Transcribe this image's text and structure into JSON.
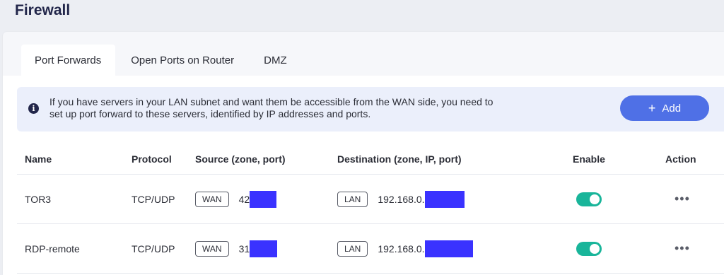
{
  "page": {
    "title": "Firewall"
  },
  "tabs": [
    {
      "label": "Port Forwards",
      "active": true
    },
    {
      "label": "Open Ports on Router",
      "active": false
    },
    {
      "label": "DMZ",
      "active": false
    }
  ],
  "info": {
    "text": "If you have servers in your LAN subnet and want them be accessible from the WAN side, you need to set up port forward to these servers, identified by IP addresses and ports.",
    "add_label": "Add",
    "add_icon": "plus-icon"
  },
  "table": {
    "headers": {
      "name": "Name",
      "protocol": "Protocol",
      "source": "Source (zone, port)",
      "destination": "Destination (zone, IP, port)",
      "enable": "Enable",
      "action": "Action"
    },
    "rows": [
      {
        "name": "TOR3",
        "protocol": "TCP/UDP",
        "source_zone": "WAN",
        "source_port": "42",
        "dest_zone": "LAN",
        "dest_ip": "192.168.0.",
        "enabled": true
      },
      {
        "name": "RDP-remote",
        "protocol": "TCP/UDP",
        "source_zone": "WAN",
        "source_port": "31",
        "dest_zone": "LAN",
        "dest_ip": "192.168.0.",
        "enabled": true
      }
    ]
  },
  "colors": {
    "accent": "#4f70e6",
    "toggle_on": "#19b59a",
    "redaction": "#3a32ff",
    "title": "#22264a"
  }
}
